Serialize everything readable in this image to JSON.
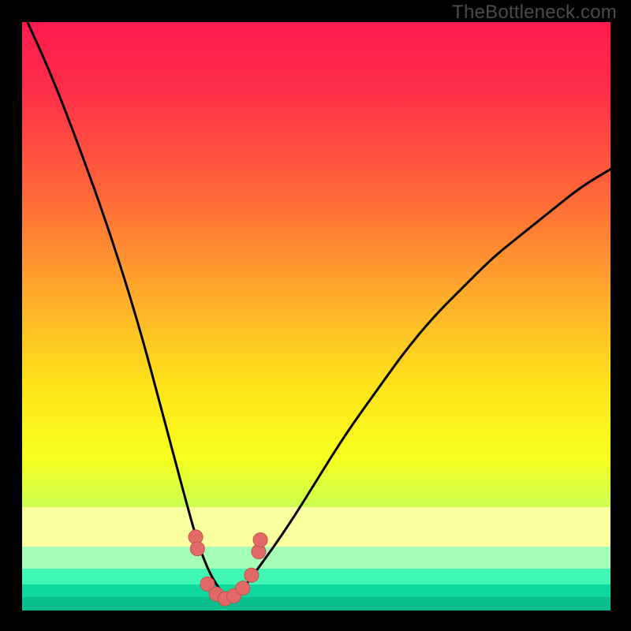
{
  "watermark": "TheBottleneck.com",
  "colors": {
    "frame": "#000000",
    "watermark": "#4b4b4b",
    "gradient_stops": [
      {
        "offset": 0.0,
        "color": "#ff1a4e"
      },
      {
        "offset": 0.12,
        "color": "#ff2f49"
      },
      {
        "offset": 0.3,
        "color": "#ff6a38"
      },
      {
        "offset": 0.48,
        "color": "#ffb22a"
      },
      {
        "offset": 0.62,
        "color": "#ffe41a"
      },
      {
        "offset": 0.74,
        "color": "#f7ff1e"
      },
      {
        "offset": 0.83,
        "color": "#c9ff55"
      },
      {
        "offset": 0.9,
        "color": "#7dff8c"
      },
      {
        "offset": 0.96,
        "color": "#2effc4"
      },
      {
        "offset": 1.0,
        "color": "#00ffc2"
      }
    ],
    "band_yellow": "#f9ff9e",
    "band_green1": "#a6ffb8",
    "band_green2": "#41f7b4",
    "band_green3": "#0fd7a0",
    "band_green4": "#08bf8d",
    "curve": "#000000",
    "marker_fill": "#e16a67",
    "marker_stroke": "#c94f4c"
  },
  "chart_data": {
    "type": "line",
    "title": "",
    "xlabel": "",
    "ylabel": "",
    "xlim": [
      0,
      100
    ],
    "ylim": [
      0,
      100
    ],
    "grid": false,
    "legend": false,
    "series": [
      {
        "name": "bottleneck-curve",
        "x": [
          0,
          5,
          10,
          15,
          20,
          24,
          28,
          30,
          32,
          34,
          35.5,
          37,
          40,
          45,
          50,
          55,
          60,
          65,
          70,
          75,
          80,
          85,
          90,
          95,
          100
        ],
        "y": [
          102,
          91,
          78,
          64,
          48,
          33,
          18,
          11,
          6,
          3,
          2,
          3,
          7,
          14,
          22,
          30,
          37,
          44,
          50,
          55,
          60,
          64,
          68,
          72,
          75
        ]
      }
    ],
    "markers": {
      "name": "fit-region",
      "x": [
        29.5,
        29.8,
        31.5,
        33.0,
        34.5,
        36.0,
        37.5,
        39.0,
        40.2,
        40.5
      ],
      "y": [
        12.5,
        10.5,
        4.5,
        2.8,
        2.0,
        2.5,
        3.8,
        6.0,
        10.0,
        12.0
      ]
    },
    "optimum_x": 35.5
  }
}
